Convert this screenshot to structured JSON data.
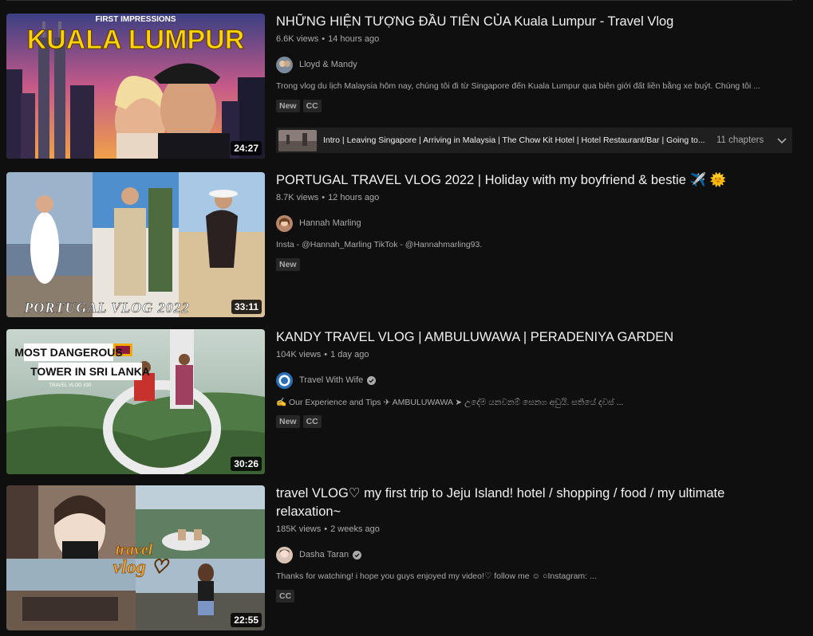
{
  "results": [
    {
      "title": "NHỮNG HIỆN TƯỢNG ĐẦU TIÊN CỦA Kuala Lumpur - Travel Vlog",
      "views": "6.6K views",
      "age": "14 hours ago",
      "channel": "Lloyd & Mandy",
      "verified": false,
      "description": "Trong vlog du lịch Malaysia hôm nay, chúng tôi đi từ Singapore đến Kuala Lumpur qua biên giới đất liền bằng xe buýt. Chúng tôi ...",
      "badges": [
        "New",
        "CC"
      ],
      "duration": "24:27",
      "thumb_text_top": "FIRST IMPRESSIONS",
      "thumb_text_main": "KUALA LUMPUR",
      "chapters_text": "Intro | Leaving Singapore | Arriving in Malaysia | The Chow Kit Hotel | Hotel Restaurant/Bar | Going to...",
      "chapters_count": "11 chapters"
    },
    {
      "title": "PORTUGAL TRAVEL VLOG 2022 | Holiday with my boyfriend & bestie ✈️ 🌞",
      "views": "8.7K views",
      "age": "12 hours ago",
      "channel": "Hannah Marling",
      "verified": false,
      "description": "Insta - @Hannah_Marling TikTok - @Hannahmarling93.",
      "badges": [
        "New"
      ],
      "duration": "33:11",
      "thumb_text_main": "PORTUGAL VLOG 2022"
    },
    {
      "title": "KANDY TRAVEL VLOG | AMBULUWAWA | PERADENIYA GARDEN",
      "views": "104K views",
      "age": "1 day ago",
      "channel": "Travel With Wife",
      "verified": true,
      "description": "✍️ Our Experience and Tips ✈ AMBULUWAWA ➤ උදේම යනවනම් සෙනග අඩුයි. සතියේ දවස් ...",
      "badges": [
        "New",
        "CC"
      ],
      "duration": "30:26",
      "thumb_text_top": "MOST DANGEROUS",
      "thumb_text_main": "TOWER IN SRI LANKA",
      "thumb_text_small": "TRAVEL VLOG #30"
    },
    {
      "title": "travel VLOG♡ my first trip to Jeju Island! hotel / shopping / food / my ultimate relaxation~",
      "views": "185K views",
      "age": "2 weeks ago",
      "channel": "Dasha Taran",
      "verified": true,
      "description": "Thanks for watching! i hope you guys enjoyed my video!♡ follow me ☺ ○Instagram: ...",
      "badges": [
        "CC"
      ],
      "duration": "22:55",
      "thumb_text_main": "travel",
      "thumb_text_sub": "vlog ♡"
    }
  ],
  "icons": {
    "verified": "verified-check-icon",
    "chapters_toggle": "chevron-down-icon"
  },
  "colors": {
    "background": "#0f0f0f",
    "text": "#f1f1f1",
    "secondary_text": "#aaaaaa",
    "badge_bg": "#272727",
    "chapters_bg": "#1f1f1f"
  }
}
